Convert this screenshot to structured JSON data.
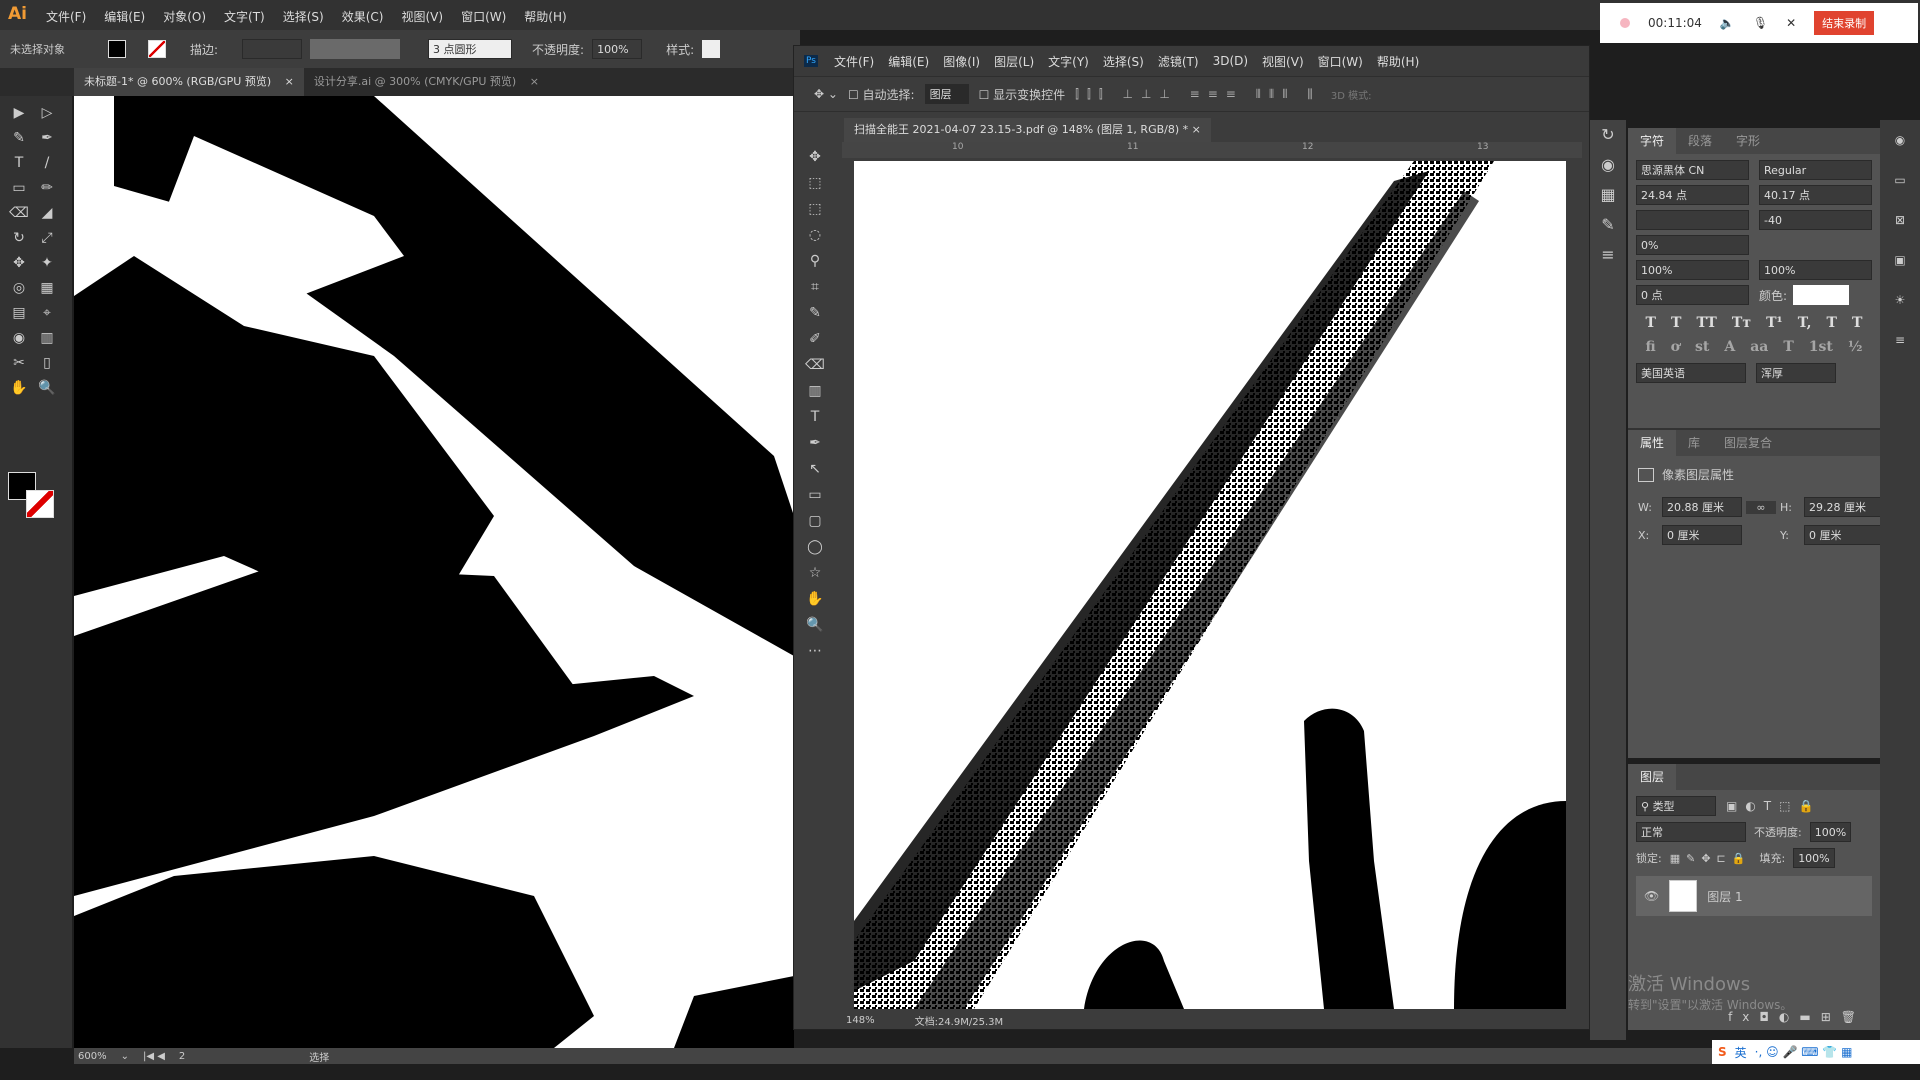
{
  "ai": {
    "logo": "Ai",
    "menu": [
      "文件(F)",
      "编辑(E)",
      "对象(O)",
      "文字(T)",
      "选择(S)",
      "效果(C)",
      "视图(V)",
      "窗口(W)",
      "帮助(H)"
    ],
    "control": {
      "selection": "未选择对象",
      "stroke_label": "描边:",
      "brush": "3 点圆形",
      "opacity_label": "不透明度:",
      "opacity": "100%",
      "style_label": "样式:"
    },
    "tabs": [
      {
        "label": "未标题-1* @ 600% (RGB/GPU 预览)",
        "active": true
      },
      {
        "label": "设计分享.ai @ 300% (CMYK/GPU 预览)",
        "active": false
      }
    ],
    "status": {
      "zoom": "600%",
      "artboard": "2",
      "mode": "选择"
    },
    "tools": [
      "▶",
      "▷",
      "✎",
      "✒",
      "T",
      "/",
      "▭",
      "✏",
      "⌫",
      "◢",
      "↻",
      "⤢",
      "✥",
      "✦",
      "◎",
      "▦",
      "▤",
      "⌖",
      "◉",
      "▥",
      "✂",
      "▯",
      "✋",
      "🔍"
    ]
  },
  "ps": {
    "logo": "Ps",
    "menu": [
      "文件(F)",
      "编辑(E)",
      "图像(I)",
      "图层(L)",
      "文字(Y)",
      "选择(S)",
      "滤镜(T)",
      "3D(D)",
      "视图(V)",
      "窗口(W)",
      "帮助(H)"
    ],
    "options": {
      "auto_select": "自动选择:",
      "target": "图层",
      "show_transform": "显示变换控件",
      "mode_3d": "3D 模式:"
    },
    "doc_tab": "扫描全能王 2021-04-07 23.15-3.pdf @ 148% (图层 1, RGB/8) *",
    "ruler": [
      "10",
      "11",
      "12",
      "13"
    ],
    "status": {
      "zoom": "148%",
      "doc": "文档:24.9M/25.3M"
    },
    "tools": [
      "✥",
      "⬚",
      "⬚",
      "◌",
      "⚲",
      "⌗",
      "✎",
      "✐",
      "⌫",
      "▥",
      "T",
      "✒",
      "↖",
      "▭",
      "▢",
      "◯",
      "☆",
      "✋",
      "🔍",
      "⋯"
    ],
    "character": {
      "tabs": [
        "字符",
        "段落",
        "字形"
      ],
      "font": "思源黑体 CN",
      "style": "Regular",
      "size": "24.84 点",
      "leading": "40.17 点",
      "kerning": "",
      "tracking": "-40",
      "scale_pct": "0%",
      "v_scale": "100%",
      "h_scale": "100%",
      "baseline": "0 点",
      "color_label": "颜色:",
      "language": "美国英语",
      "aa": "浑厚",
      "format_buttons": [
        "T",
        "T",
        "TT",
        "Tт",
        "T¹",
        "T,",
        "T",
        "T"
      ],
      "ot_buttons": [
        "fi",
        "ơ",
        "st",
        "A",
        "aa",
        "T",
        "1st",
        "½"
      ]
    },
    "properties": {
      "tabs": [
        "属性",
        "库",
        "图层复合"
      ],
      "title": "像素图层属性",
      "w_label": "W:",
      "w": "20.88 厘米",
      "h_label": "H:",
      "h": "29.28 厘米",
      "x_label": "X:",
      "x": "0 厘米",
      "y_label": "Y:",
      "y": "0 厘米"
    },
    "layers": {
      "tab": "图层",
      "filter": "类型",
      "blend": "正常",
      "opacity_label": "不透明度:",
      "opacity": "100%",
      "lock_label": "锁定:",
      "fill_label": "填充:",
      "fill": "100%",
      "items": [
        {
          "name": "图层 1",
          "visible": true
        }
      ]
    }
  },
  "recorder": {
    "time": "00:11:04",
    "stop": "结束录制"
  },
  "watermark": {
    "title": "激活 Windows",
    "subtitle": "转到\"设置\"以激活 Windows。"
  },
  "ime": {
    "lang": "英"
  },
  "colors": {
    "ai_bg": "#323232",
    "ps_bg": "#3c3c3c",
    "panel": "#535353",
    "rec_button": "#e0432f"
  }
}
